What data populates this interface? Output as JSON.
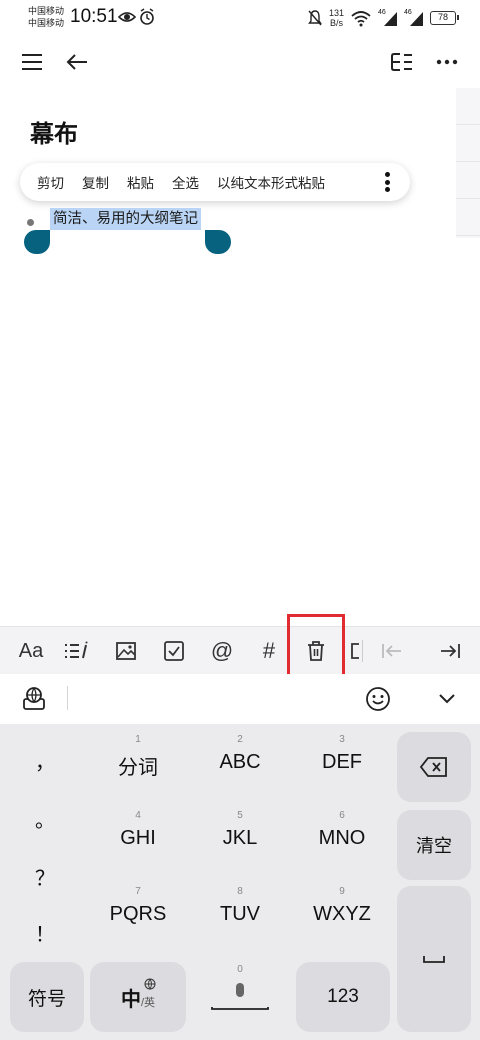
{
  "status": {
    "carrier1": "中国移动",
    "carrier2": "中国移动",
    "time": "10:51",
    "netspeed_value": "131",
    "netspeed_unit": "B/s",
    "signal1_label": "46",
    "signal2_label": "46",
    "battery": "78"
  },
  "doc": {
    "title": "幕布",
    "bullet_text": "简洁、易用的大纲笔记"
  },
  "context_menu": {
    "items": [
      "剪切",
      "复制",
      "粘贴",
      "全选",
      "以纯文本形式粘贴"
    ]
  },
  "format_bar": {
    "font_label": "Aa",
    "hash_label": "#",
    "at_label": "@"
  },
  "keyboard": {
    "punct": [
      "，",
      "。",
      "？",
      "！"
    ],
    "keys": [
      {
        "num": "1",
        "label": "分词"
      },
      {
        "num": "2",
        "label": "ABC"
      },
      {
        "num": "3",
        "label": "DEF"
      },
      {
        "num": "4",
        "label": "GHI"
      },
      {
        "num": "5",
        "label": "JKL"
      },
      {
        "num": "6",
        "label": "MNO"
      },
      {
        "num": "7",
        "label": "PQRS"
      },
      {
        "num": "8",
        "label": "TUV"
      },
      {
        "num": "9",
        "label": "WXYZ"
      }
    ],
    "clear_label": "清空",
    "symbol_label": "符号",
    "lang_main": "中",
    "lang_sub": "/英",
    "zero_num": "0",
    "numeric_label": "123"
  },
  "colors": {
    "selection": "#b9d4f4",
    "handle": "#07627f",
    "highlight": "#e02b30"
  }
}
